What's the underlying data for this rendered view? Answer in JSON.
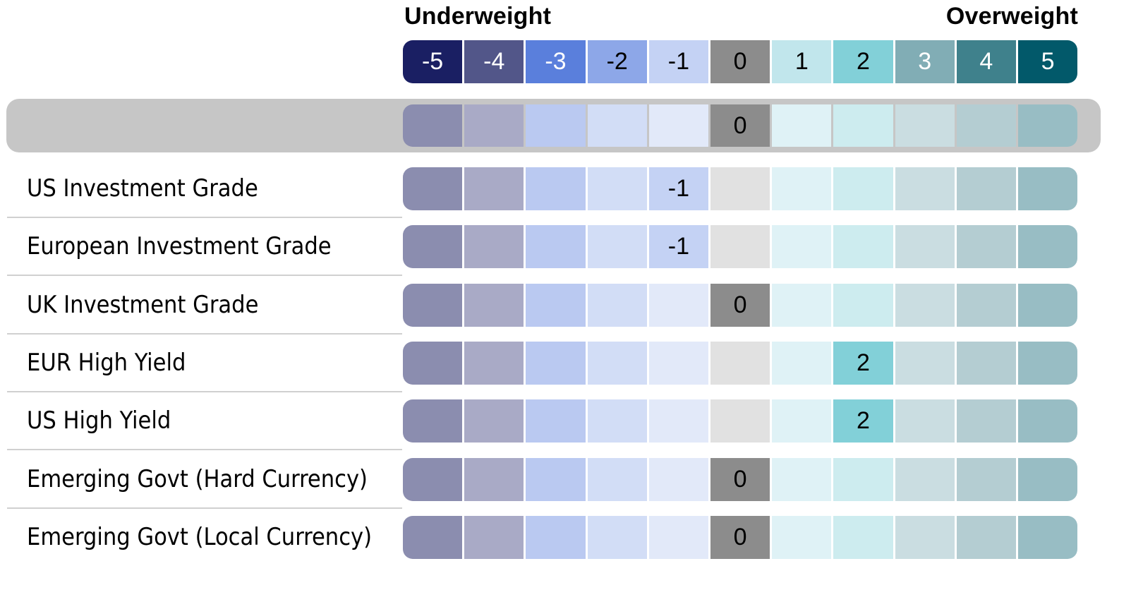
{
  "chart_data": {
    "type": "heatmap",
    "title": "",
    "scale_left_label": "Underweight",
    "scale_right_label": "Overweight",
    "scale": [
      -5,
      -4,
      -3,
      -2,
      -1,
      0,
      1,
      2,
      3,
      4,
      5
    ],
    "scale_colors": [
      "#1a1f63",
      "#525689",
      "#5a7fdc",
      "#8da7e8",
      "#c4d2f4",
      "#8c8c8c",
      "#c1e6ec",
      "#82d0d8",
      "#81adb5",
      "#3f818c",
      "#02596a"
    ],
    "scale_text_colors": [
      "#ffffff",
      "#ffffff",
      "#ffffff",
      "#000000",
      "#000000",
      "#000000",
      "#000000",
      "#000000",
      "#ffffff",
      "#ffffff",
      "#ffffff"
    ],
    "muted_colors": [
      "#8b8daf",
      "#a9aac6",
      "#bac9f1",
      "#d2ddf6",
      "#e2e9f9",
      "#e1e1e1",
      "#dff2f6",
      "#cdecef",
      "#cadde1",
      "#b4cdd2",
      "#98bdc4"
    ],
    "zero_active_color": "#8c8c8c",
    "highlight_band_color": "#c6c6c6",
    "summary_row": {
      "label": "",
      "value": 0
    },
    "rows": [
      {
        "label": "US Investment Grade",
        "value": -1
      },
      {
        "label": "European Investment Grade",
        "value": -1
      },
      {
        "label": "UK Investment Grade",
        "value": 0
      },
      {
        "label": "EUR High Yield",
        "value": 2
      },
      {
        "label": "US High Yield",
        "value": 2
      },
      {
        "label": "Emerging Govt (Hard Currency)",
        "value": 0
      },
      {
        "label": "Emerging Govt (Local Currency)",
        "value": 0
      }
    ]
  }
}
